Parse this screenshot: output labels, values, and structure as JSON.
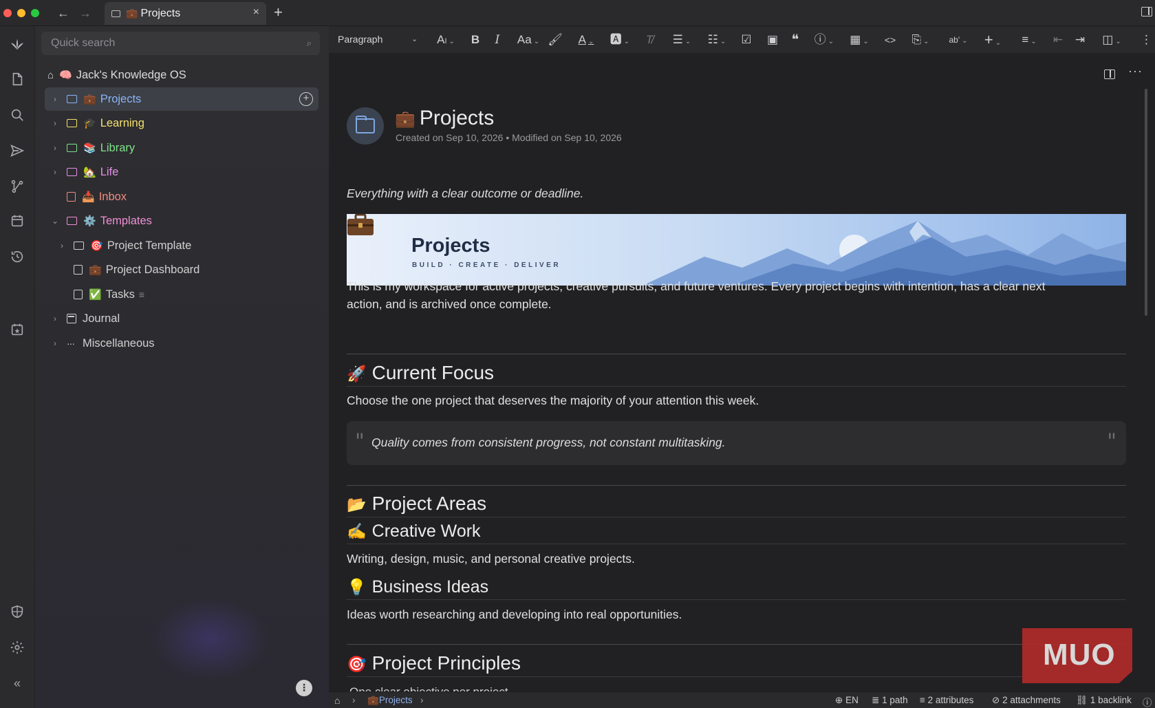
{
  "tab": {
    "title": "Projects",
    "emoji": "💼"
  },
  "search": {
    "placeholder": "Quick search"
  },
  "tree": {
    "root": {
      "label": "Jack's Knowledge OS",
      "emoji": "🧠"
    },
    "items": [
      {
        "label": "Projects",
        "emoji": "💼",
        "color": "#8ab4f8"
      },
      {
        "label": "Learning",
        "emoji": "🎓",
        "color": "#f4e06d"
      },
      {
        "label": "Library",
        "emoji": "📚",
        "color": "#7ee28a"
      },
      {
        "label": "Life",
        "emoji": "🏡",
        "color": "#e68ee8"
      },
      {
        "label": "Inbox",
        "emoji": "📥",
        "color": "#f28b82"
      },
      {
        "label": "Templates",
        "emoji": "⚙️",
        "color": "#f08fd6"
      },
      {
        "label": "Project Template",
        "emoji": "🎯",
        "color": "#d0d0d0"
      },
      {
        "label": "Project Dashboard",
        "emoji": "💼",
        "color": "#d0d0d0"
      },
      {
        "label": "Tasks",
        "emoji": "✅",
        "color": "#d0d0d0",
        "suffix": "≡"
      },
      {
        "label": "Journal",
        "emoji": "",
        "color": "#d0d0d0"
      },
      {
        "label": "Miscellaneous",
        "emoji": "",
        "color": "#d0d0d0"
      }
    ]
  },
  "toolbar": {
    "block_type": "Paragraph"
  },
  "note": {
    "title": "Projects",
    "emoji": "💼",
    "meta": "Created on Sep 10, 2026 • Modified on Sep 10, 2026",
    "tagline": "Everything with a clear outcome or deadline.",
    "banner": {
      "title": "Projects",
      "subtitle": "BUILD · CREATE · DELIVER"
    },
    "intro_line1": "This is my workspace for active projects, creative pursuits, and future ventures. Every project begins with intention, has a clear next",
    "intro_line2": "action, and is archived once complete.",
    "focus": {
      "emoji": "🚀",
      "heading": "Current Focus",
      "text": "Choose the one project that deserves the majority of your attention this week.",
      "quote": "Quality comes from consistent progress, not constant multitasking."
    },
    "areas": {
      "emoji": "📂",
      "heading": "Project Areas",
      "creative": {
        "emoji": "✍️",
        "heading": "Creative Work",
        "text": "Writing, design, music, and personal creative projects."
      },
      "business": {
        "emoji": "💡",
        "heading": "Business Ideas",
        "text": "Ideas worth researching and developing into real opportunities."
      }
    },
    "principles": {
      "emoji": "🎯",
      "heading": "Project Principles",
      "first_item": "One clear objective per project"
    }
  },
  "watermark": "MUO",
  "statusbar": {
    "crumb_emoji": "💼",
    "crumb": "Projects",
    "lang": "EN",
    "paths": "1 path",
    "attributes": "2 attributes",
    "attachments": "2 attachments",
    "backlinks": "1 backlink"
  }
}
